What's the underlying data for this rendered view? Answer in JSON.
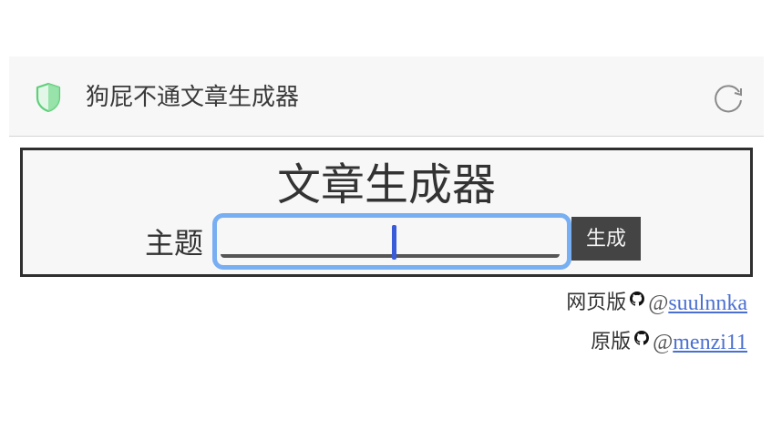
{
  "appbar": {
    "title": "狗屁不通文章生成器",
    "shield_icon": "shield-icon",
    "reload_icon": "reload-icon",
    "shield_color": "#5fcf7a"
  },
  "generator": {
    "heading": "文章生成器",
    "topic_label": "主题",
    "topic_value": "",
    "generate_label": "生成",
    "input_focus_color": "#78aef2",
    "button_color": "#444444"
  },
  "credits": [
    {
      "label": "网页版",
      "icon": "github-icon",
      "at": "@",
      "handle": "suulnnka"
    },
    {
      "label": "原版",
      "icon": "github-icon",
      "at": "@",
      "handle": "menzi11"
    }
  ]
}
